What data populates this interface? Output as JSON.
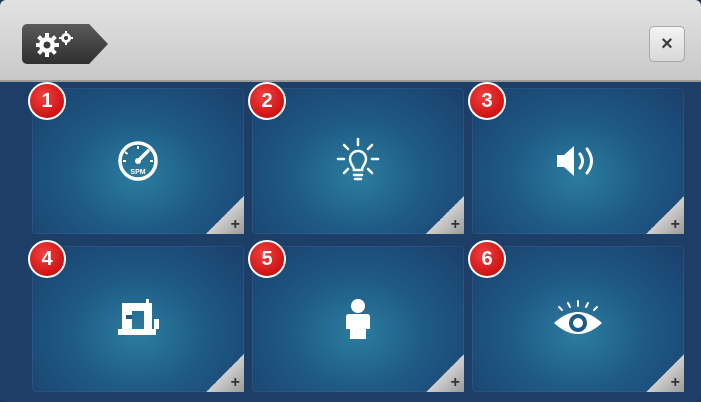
{
  "header": {
    "settings_icon": "gears-icon",
    "close_label": "×"
  },
  "tiles": [
    {
      "number": "1",
      "icon": "speedometer-icon",
      "icon_text": "SPM",
      "corner": "+"
    },
    {
      "number": "2",
      "icon": "light-bulb-icon",
      "corner": "+"
    },
    {
      "number": "3",
      "icon": "speaker-icon",
      "corner": "+"
    },
    {
      "number": "4",
      "icon": "sewing-machine-icon",
      "corner": "+"
    },
    {
      "number": "5",
      "icon": "person-icon",
      "corner": "+"
    },
    {
      "number": "6",
      "icon": "eye-icon",
      "corner": "+"
    }
  ],
  "colors": {
    "badge": "#d00000",
    "tile": "#1e5a85",
    "header": "#d6d6d6"
  }
}
